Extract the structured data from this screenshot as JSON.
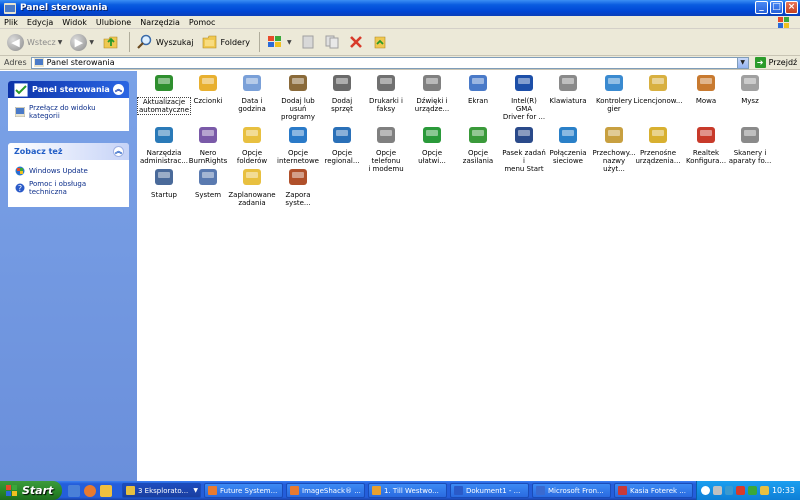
{
  "window": {
    "title": "Panel sterowania"
  },
  "menubar": {
    "items": [
      "Plik",
      "Edycja",
      "Widok",
      "Ulubione",
      "Narzędzia",
      "Pomoc"
    ]
  },
  "toolbar": {
    "back_label": "Wstecz",
    "search_label": "Wyszukaj",
    "folders_label": "Foldery"
  },
  "address": {
    "label": "Adres",
    "value": "Panel sterowania",
    "go_label": "Przejdź"
  },
  "leftpane": {
    "panel1": {
      "title": "Panel sterowania",
      "items": [
        "Przełącz do widoku kategorii"
      ]
    },
    "panel2": {
      "title": "Zobacz też",
      "items": [
        "Windows Update",
        "Pomoc i obsługa techniczna"
      ]
    }
  },
  "items": [
    {
      "line1": "Aktualizacje",
      "line2": "automatyczne",
      "icon": "automatic-updates-icon",
      "color": "#2f8f2f",
      "selected": true
    },
    {
      "line1": "Czcionki",
      "line2": "",
      "icon": "fonts-icon",
      "color": "#e8b030"
    },
    {
      "line1": "Data i godzina",
      "line2": "",
      "icon": "date-time-icon",
      "color": "#7aa0d8"
    },
    {
      "line1": "Dodaj lub usuń",
      "line2": "programy",
      "icon": "add-remove-programs-icon",
      "color": "#8a6a3a"
    },
    {
      "line1": "Dodaj sprzęt",
      "line2": "",
      "icon": "add-hardware-icon",
      "color": "#6a6a6a"
    },
    {
      "line1": "Drukarki i",
      "line2": "faksy",
      "icon": "printers-icon",
      "color": "#707070"
    },
    {
      "line1": "Dźwięki i",
      "line2": "urządze...",
      "icon": "sounds-icon",
      "color": "#808080"
    },
    {
      "line1": "Ekran",
      "line2": "",
      "icon": "display-icon",
      "color": "#4a7ac8"
    },
    {
      "line1": "Intel(R) GMA",
      "line2": "Driver for ...",
      "icon": "intel-gma-icon",
      "color": "#1d4fa8"
    },
    {
      "line1": "Klawiatura",
      "line2": "",
      "icon": "keyboard-icon",
      "color": "#8a8a8a"
    },
    {
      "line1": "Kontrolery gier",
      "line2": "",
      "icon": "game-controllers-icon",
      "color": "#3a8ad0"
    },
    {
      "line1": "Licencjonow...",
      "line2": "",
      "icon": "licensing-icon",
      "color": "#d8b040"
    },
    {
      "line1": "Mowa",
      "line2": "",
      "icon": "speech-icon",
      "color": "#c87a30"
    },
    {
      "line1": "Mysz",
      "line2": "",
      "icon": "mouse-icon",
      "color": "#a0a0a0"
    },
    {
      "line1": "Narzędzia",
      "line2": "administrac...",
      "icon": "admin-tools-icon",
      "color": "#2a7ab8"
    },
    {
      "line1": "Nero",
      "line2": "BurnRights",
      "icon": "nero-icon",
      "color": "#7a5aa8"
    },
    {
      "line1": "Opcje",
      "line2": "folderów",
      "icon": "folder-options-icon",
      "color": "#e8c040"
    },
    {
      "line1": "Opcje",
      "line2": "internetowe",
      "icon": "internet-options-icon",
      "color": "#2a7ac8"
    },
    {
      "line1": "Opcje",
      "line2": "regional...",
      "icon": "regional-options-icon",
      "color": "#2a70b8"
    },
    {
      "line1": "Opcje telefonu",
      "line2": "i modemu",
      "icon": "phone-modem-icon",
      "color": "#808080"
    },
    {
      "line1": "Opcje",
      "line2": "ułatwi...",
      "icon": "accessibility-icon",
      "color": "#2a9a3a"
    },
    {
      "line1": "Opcje zasilania",
      "line2": "",
      "icon": "power-options-icon",
      "color": "#3a9a3a"
    },
    {
      "line1": "Pasek zadań i",
      "line2": "menu Start",
      "icon": "taskbar-start-icon",
      "color": "#2a4a8a"
    },
    {
      "line1": "Połączenia",
      "line2": "sieciowe",
      "icon": "network-connections-icon",
      "color": "#2a80c8"
    },
    {
      "line1": "Przechowy...",
      "line2": "nazwy użyt...",
      "icon": "stored-usernames-icon",
      "color": "#c8a040"
    },
    {
      "line1": "Przenośne",
      "line2": "urządzenia...",
      "icon": "portable-devices-icon",
      "color": "#d8b030"
    },
    {
      "line1": "Realtek",
      "line2": "Konfigura...",
      "icon": "realtek-icon",
      "color": "#c83a2a"
    },
    {
      "line1": "Skanery i",
      "line2": "aparaty fo...",
      "icon": "scanners-cameras-icon",
      "color": "#8a8a8a"
    },
    {
      "line1": "Startup",
      "line2": "",
      "icon": "startup-icon",
      "color": "#4a6a9a"
    },
    {
      "line1": "System",
      "line2": "",
      "icon": "system-icon",
      "color": "#5a7ab0"
    },
    {
      "line1": "Zaplanowane",
      "line2": "zadania",
      "icon": "scheduled-tasks-icon",
      "color": "#e8c040"
    },
    {
      "line1": "Zapora",
      "line2": "syste...",
      "icon": "firewall-icon",
      "color": "#b0502a"
    }
  ],
  "taskbar": {
    "start_label": "Start",
    "tasks": [
      {
        "label": "3 Eksplorato...",
        "active": true,
        "color": "#e8c040"
      },
      {
        "label": "Future System...",
        "active": false,
        "color": "#e87a30"
      },
      {
        "label": "ImageShack® ...",
        "active": false,
        "color": "#e87a30"
      },
      {
        "label": "1. Till Westwo...",
        "active": false,
        "color": "#e8a030"
      },
      {
        "label": "Dokument1 - ...",
        "active": false,
        "color": "#2a5ac8"
      },
      {
        "label": "Microsoft Fron...",
        "active": false,
        "color": "#3a6ad0"
      },
      {
        "label": "Kasia Foterek ...",
        "active": false,
        "color": "#c83a3a"
      }
    ],
    "clock": "10:33"
  }
}
